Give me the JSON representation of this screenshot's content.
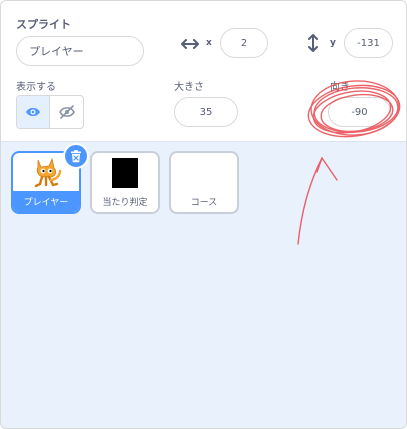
{
  "sprite_info": {
    "sprite_label": "スプライト",
    "sprite_name": "プレイヤー",
    "x_label": "x",
    "x_value": "2",
    "y_label": "y",
    "y_value": "-131",
    "show_label": "表示する",
    "size_label": "大きさ",
    "size_value": "35",
    "direction_label": "向き",
    "direction_value": "-90"
  },
  "sprites": [
    {
      "name": "プレイヤー",
      "selected": true,
      "thumb": "cat-costume"
    },
    {
      "name": "当たり判定",
      "selected": false,
      "thumb": "black-square"
    },
    {
      "name": "コース",
      "selected": false,
      "thumb": "empty"
    }
  ],
  "colors": {
    "accent": "#4c97ff",
    "panel_bg": "#e9f1fc",
    "annotation": "#e8484e"
  },
  "icons": [
    "horizontal-arrow-icon",
    "vertical-arrow-icon",
    "eye-icon",
    "eye-slash-icon",
    "trash-icon",
    "cat-sprite-icon"
  ]
}
